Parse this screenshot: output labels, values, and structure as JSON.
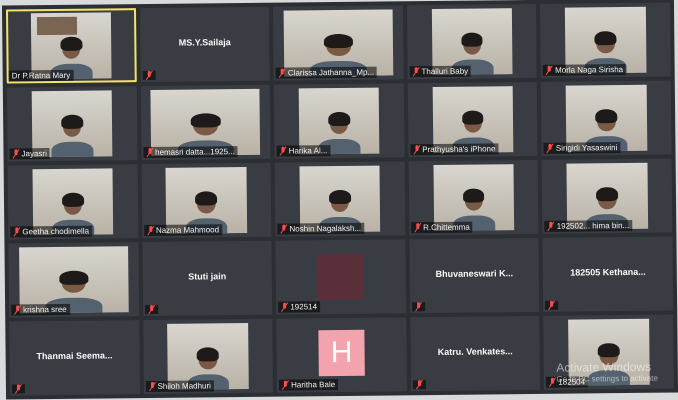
{
  "participants": [
    {
      "name": "Dr P.Ratna Mary",
      "video": true,
      "active": true
    },
    {
      "name": "MS.Y.Sailaja",
      "video": false
    },
    {
      "name": "Clarissa Jathanna_Mp...",
      "video": true
    },
    {
      "name": "Thalluri Baby",
      "video": true
    },
    {
      "name": "Morla Naga Sirisha",
      "video": true
    },
    {
      "name": "Jayasri",
      "video": true
    },
    {
      "name": "hemasri datta...1925...",
      "video": true
    },
    {
      "name": "Harika Al...",
      "video": true
    },
    {
      "name": "Prathyusha's iPhone",
      "video": true
    },
    {
      "name": "Sirigidi Yasaswini",
      "video": true
    },
    {
      "name": "Geetha chodimella",
      "video": true
    },
    {
      "name": "Nazma Mahmood",
      "video": true
    },
    {
      "name": "Noshin Nagalaksh...",
      "video": true
    },
    {
      "name": "R.Chittemma",
      "video": true
    },
    {
      "name": "192502... hima bin...",
      "video": true
    },
    {
      "name": "krishna sree",
      "video": true
    },
    {
      "name": "Stuti jain",
      "video": false
    },
    {
      "name": "192514",
      "video": false,
      "avatar": "dark"
    },
    {
      "name": "Bhuvaneswari K...",
      "video": false
    },
    {
      "name": "182505 Kethana...",
      "video": false
    },
    {
      "name": "Thanmai Seema...",
      "video": false
    },
    {
      "name": "Shiloh Madhuri",
      "video": true
    },
    {
      "name": "Haritha Bale",
      "video": false,
      "avatar": "letter",
      "letter": "H"
    },
    {
      "name": "Katru. Venkates...",
      "video": false
    },
    {
      "name": "182504",
      "video": true
    }
  ],
  "watermark": {
    "line1": "Activate Windows",
    "line2": "Go to PC settings to activate"
  }
}
